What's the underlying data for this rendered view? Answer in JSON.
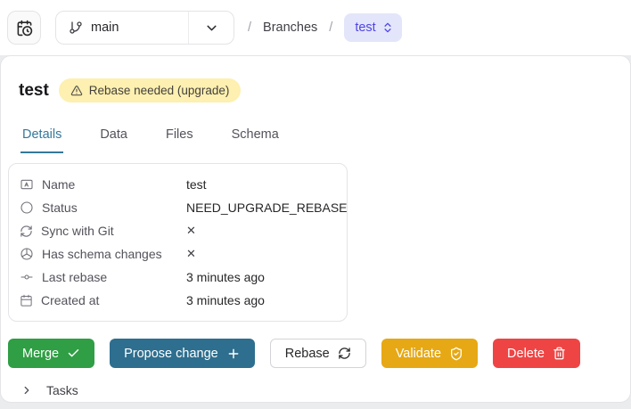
{
  "header": {
    "branch_selector": {
      "value": "main"
    },
    "breadcrumb": {
      "sep1": "/",
      "section": "Branches",
      "sep2": "/",
      "current": "test"
    }
  },
  "branch": {
    "title": "test",
    "warning_badge": "Rebase needed (upgrade)"
  },
  "tabs": [
    {
      "label": "Details",
      "active": true
    },
    {
      "label": "Data",
      "active": false
    },
    {
      "label": "Files",
      "active": false
    },
    {
      "label": "Schema",
      "active": false
    }
  ],
  "details": {
    "rows": [
      {
        "icon": "name-badge-icon",
        "label": "Name",
        "value": "test"
      },
      {
        "icon": "status-circle-icon",
        "label": "Status",
        "value": "NEED_UPGRADE_REBASE"
      },
      {
        "icon": "sync-icon",
        "label": "Sync with Git",
        "value": "✕"
      },
      {
        "icon": "schema-sphere-icon",
        "label": "Has schema changes",
        "value": "✕"
      },
      {
        "icon": "commit-icon",
        "label": "Last rebase",
        "value": "3 minutes ago"
      },
      {
        "icon": "calendar-icon",
        "label": "Created at",
        "value": "3 minutes ago"
      }
    ]
  },
  "actions": {
    "merge": "Merge",
    "propose": "Propose change",
    "rebase": "Rebase",
    "validate": "Validate",
    "delete": "Delete"
  },
  "tasks": {
    "label": "Tasks"
  },
  "colors": {
    "tab_active": "#35789b",
    "merge_green": "#2f9e44",
    "propose_blue": "#2e6e8e",
    "validate_amber": "#e6a814",
    "delete_red": "#ef4444",
    "badge_yellow_bg": "#fdf0b0",
    "breadcrumb_pill_bg": "#e3e5fa",
    "breadcrumb_pill_text": "#4f46e5"
  }
}
